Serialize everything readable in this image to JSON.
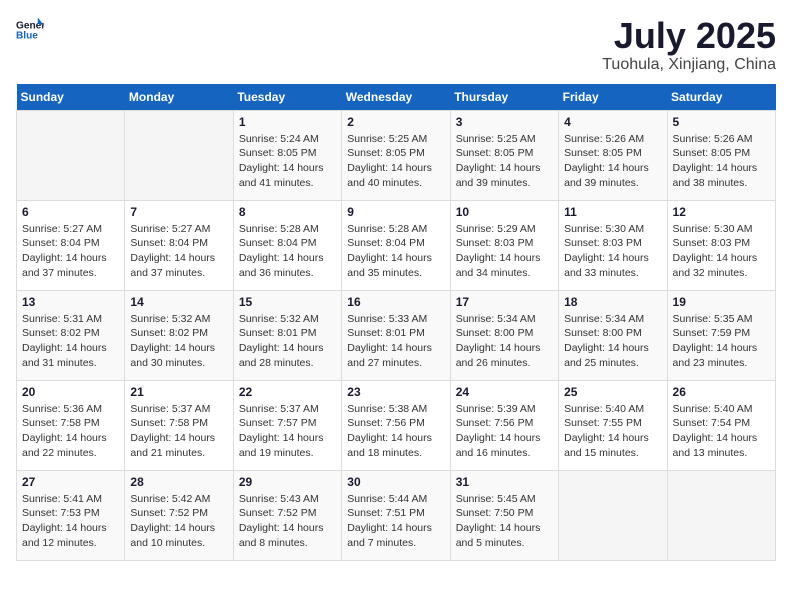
{
  "header": {
    "logo_general": "General",
    "logo_blue": "Blue",
    "month": "July 2025",
    "location": "Tuohula, Xinjiang, China"
  },
  "weekdays": [
    "Sunday",
    "Monday",
    "Tuesday",
    "Wednesday",
    "Thursday",
    "Friday",
    "Saturday"
  ],
  "weeks": [
    [
      {
        "day": "",
        "info": ""
      },
      {
        "day": "",
        "info": ""
      },
      {
        "day": "1",
        "info": "Sunrise: 5:24 AM\nSunset: 8:05 PM\nDaylight: 14 hours and 41 minutes."
      },
      {
        "day": "2",
        "info": "Sunrise: 5:25 AM\nSunset: 8:05 PM\nDaylight: 14 hours and 40 minutes."
      },
      {
        "day": "3",
        "info": "Sunrise: 5:25 AM\nSunset: 8:05 PM\nDaylight: 14 hours and 39 minutes."
      },
      {
        "day": "4",
        "info": "Sunrise: 5:26 AM\nSunset: 8:05 PM\nDaylight: 14 hours and 39 minutes."
      },
      {
        "day": "5",
        "info": "Sunrise: 5:26 AM\nSunset: 8:05 PM\nDaylight: 14 hours and 38 minutes."
      }
    ],
    [
      {
        "day": "6",
        "info": "Sunrise: 5:27 AM\nSunset: 8:04 PM\nDaylight: 14 hours and 37 minutes."
      },
      {
        "day": "7",
        "info": "Sunrise: 5:27 AM\nSunset: 8:04 PM\nDaylight: 14 hours and 37 minutes."
      },
      {
        "day": "8",
        "info": "Sunrise: 5:28 AM\nSunset: 8:04 PM\nDaylight: 14 hours and 36 minutes."
      },
      {
        "day": "9",
        "info": "Sunrise: 5:28 AM\nSunset: 8:04 PM\nDaylight: 14 hours and 35 minutes."
      },
      {
        "day": "10",
        "info": "Sunrise: 5:29 AM\nSunset: 8:03 PM\nDaylight: 14 hours and 34 minutes."
      },
      {
        "day": "11",
        "info": "Sunrise: 5:30 AM\nSunset: 8:03 PM\nDaylight: 14 hours and 33 minutes."
      },
      {
        "day": "12",
        "info": "Sunrise: 5:30 AM\nSunset: 8:03 PM\nDaylight: 14 hours and 32 minutes."
      }
    ],
    [
      {
        "day": "13",
        "info": "Sunrise: 5:31 AM\nSunset: 8:02 PM\nDaylight: 14 hours and 31 minutes."
      },
      {
        "day": "14",
        "info": "Sunrise: 5:32 AM\nSunset: 8:02 PM\nDaylight: 14 hours and 30 minutes."
      },
      {
        "day": "15",
        "info": "Sunrise: 5:32 AM\nSunset: 8:01 PM\nDaylight: 14 hours and 28 minutes."
      },
      {
        "day": "16",
        "info": "Sunrise: 5:33 AM\nSunset: 8:01 PM\nDaylight: 14 hours and 27 minutes."
      },
      {
        "day": "17",
        "info": "Sunrise: 5:34 AM\nSunset: 8:00 PM\nDaylight: 14 hours and 26 minutes."
      },
      {
        "day": "18",
        "info": "Sunrise: 5:34 AM\nSunset: 8:00 PM\nDaylight: 14 hours and 25 minutes."
      },
      {
        "day": "19",
        "info": "Sunrise: 5:35 AM\nSunset: 7:59 PM\nDaylight: 14 hours and 23 minutes."
      }
    ],
    [
      {
        "day": "20",
        "info": "Sunrise: 5:36 AM\nSunset: 7:58 PM\nDaylight: 14 hours and 22 minutes."
      },
      {
        "day": "21",
        "info": "Sunrise: 5:37 AM\nSunset: 7:58 PM\nDaylight: 14 hours and 21 minutes."
      },
      {
        "day": "22",
        "info": "Sunrise: 5:37 AM\nSunset: 7:57 PM\nDaylight: 14 hours and 19 minutes."
      },
      {
        "day": "23",
        "info": "Sunrise: 5:38 AM\nSunset: 7:56 PM\nDaylight: 14 hours and 18 minutes."
      },
      {
        "day": "24",
        "info": "Sunrise: 5:39 AM\nSunset: 7:56 PM\nDaylight: 14 hours and 16 minutes."
      },
      {
        "day": "25",
        "info": "Sunrise: 5:40 AM\nSunset: 7:55 PM\nDaylight: 14 hours and 15 minutes."
      },
      {
        "day": "26",
        "info": "Sunrise: 5:40 AM\nSunset: 7:54 PM\nDaylight: 14 hours and 13 minutes."
      }
    ],
    [
      {
        "day": "27",
        "info": "Sunrise: 5:41 AM\nSunset: 7:53 PM\nDaylight: 14 hours and 12 minutes."
      },
      {
        "day": "28",
        "info": "Sunrise: 5:42 AM\nSunset: 7:52 PM\nDaylight: 14 hours and 10 minutes."
      },
      {
        "day": "29",
        "info": "Sunrise: 5:43 AM\nSunset: 7:52 PM\nDaylight: 14 hours and 8 minutes."
      },
      {
        "day": "30",
        "info": "Sunrise: 5:44 AM\nSunset: 7:51 PM\nDaylight: 14 hours and 7 minutes."
      },
      {
        "day": "31",
        "info": "Sunrise: 5:45 AM\nSunset: 7:50 PM\nDaylight: 14 hours and 5 minutes."
      },
      {
        "day": "",
        "info": ""
      },
      {
        "day": "",
        "info": ""
      }
    ]
  ]
}
